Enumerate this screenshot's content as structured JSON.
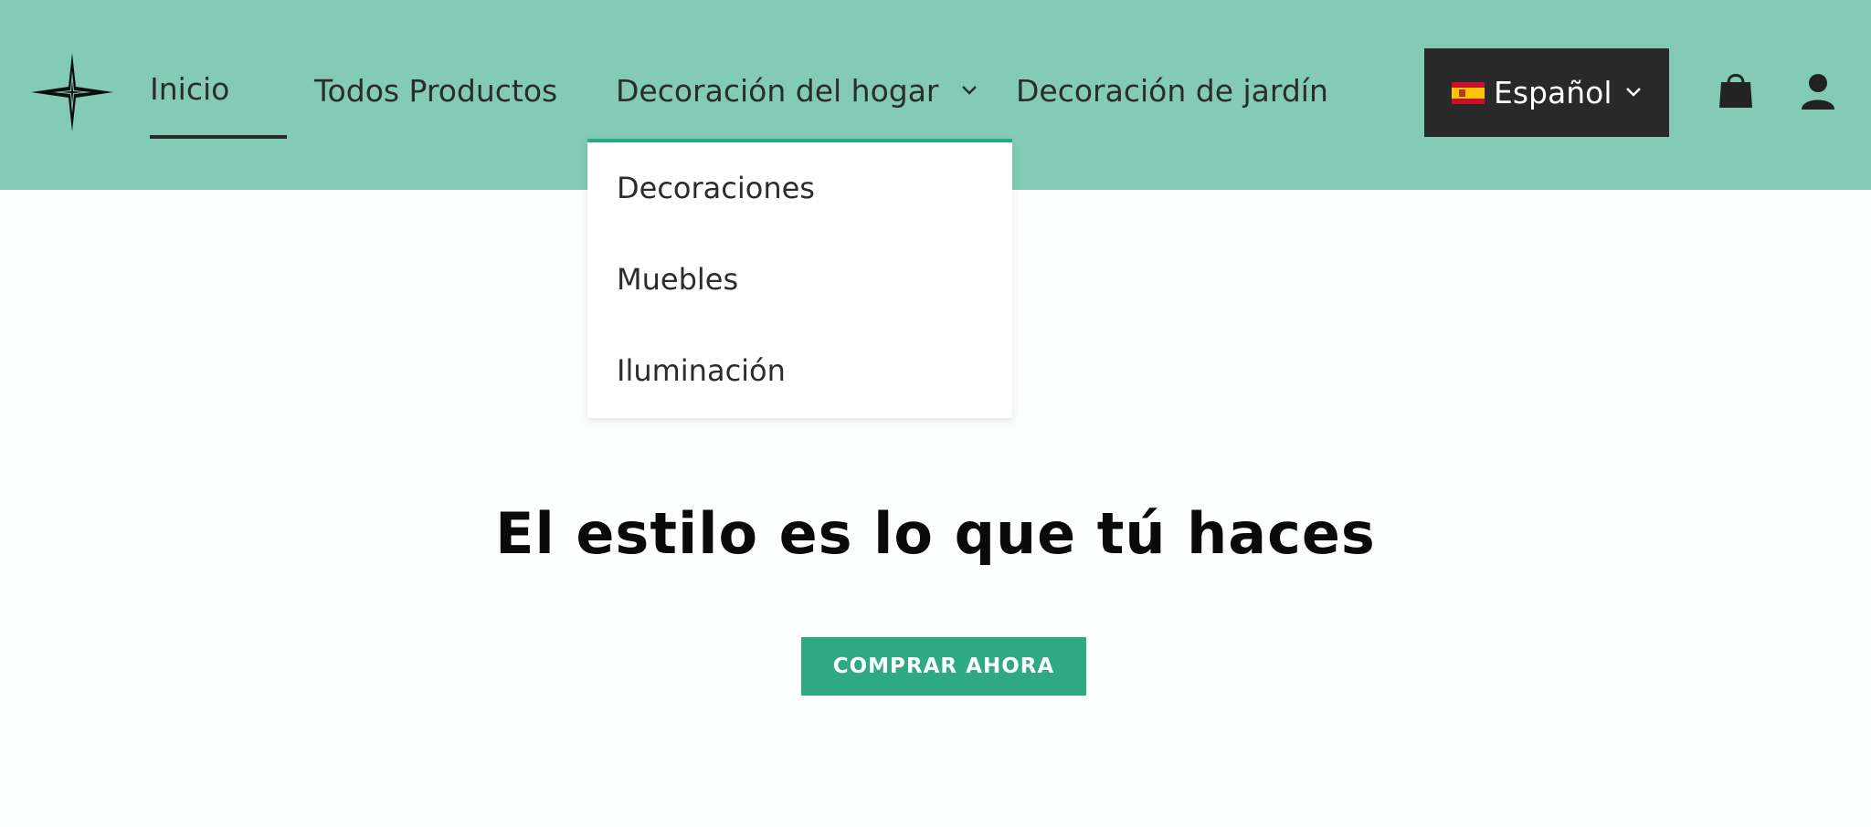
{
  "header": {
    "background": "#83cbb5",
    "logo_icon": "four-point-star-icon",
    "nav": [
      {
        "label": "Inicio",
        "active": true
      },
      {
        "label": "Todos Productos"
      },
      {
        "label": "Decoración del hogar",
        "has_dropdown": true,
        "expanded": true
      },
      {
        "label": "Decoración de jardín"
      }
    ],
    "language": {
      "label": "Español",
      "flag_icon": "spain-flag-icon"
    },
    "icons": {
      "cart": "shopping-bag-icon",
      "account": "user-icon"
    }
  },
  "dropdown": {
    "accent": "#2daa83",
    "items": [
      {
        "label": "Decoraciones"
      },
      {
        "label": "Muebles"
      },
      {
        "label": "Iluminación"
      }
    ]
  },
  "hero": {
    "title": "El estilo es lo que tú haces",
    "cta_label": "COMPRAR AHORA",
    "cta_color": "#2daa83"
  }
}
